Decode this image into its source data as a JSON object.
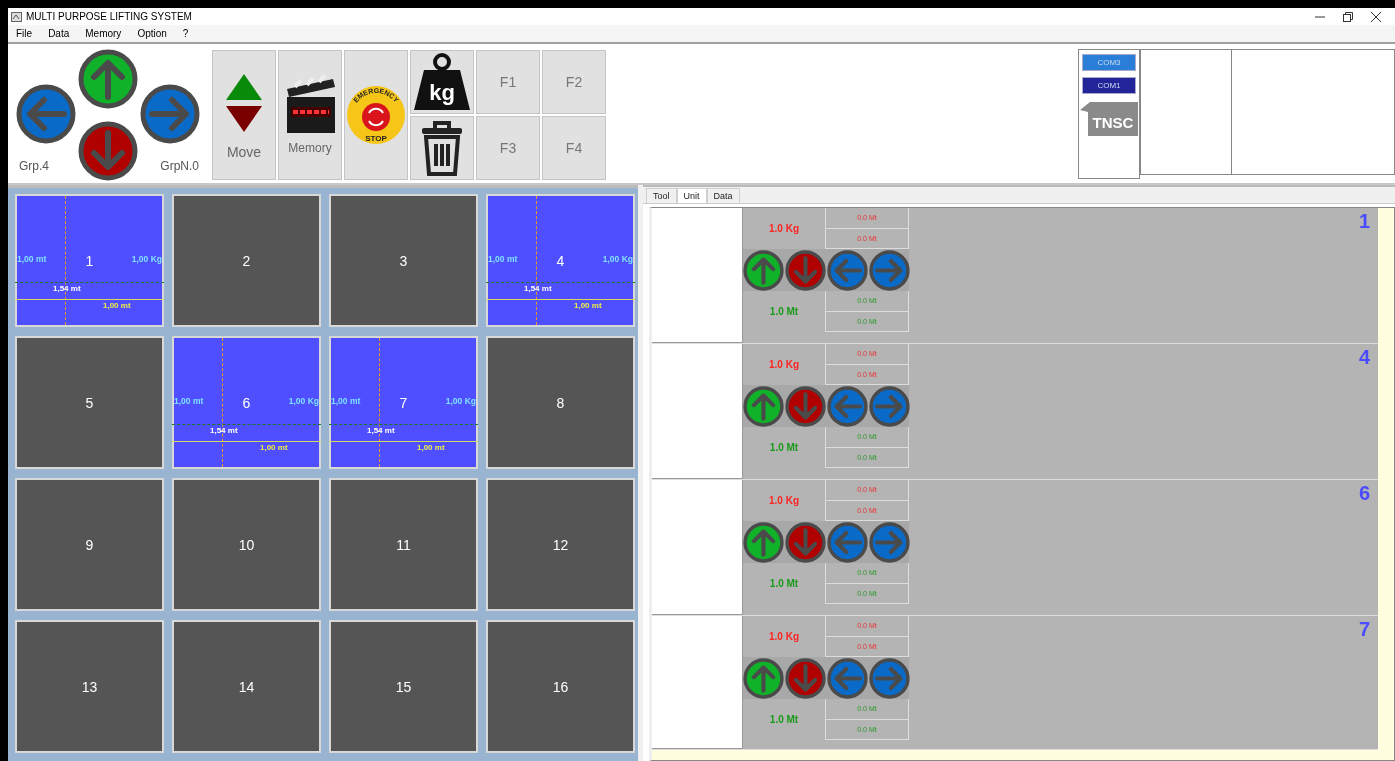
{
  "window": {
    "title": "MULTI PURPOSE LIFTING SYSTEM"
  },
  "menu": [
    "File",
    "Data",
    "Memory",
    "Option",
    "?"
  ],
  "joystick": {
    "group_label": "Grp.4",
    "group_number_label": "GrpN.0"
  },
  "toolbar": {
    "move_label": "Move",
    "memory_label": "Memory",
    "emergency_top": "EMERGENCY",
    "emergency_bottom": "STOP",
    "weight_label": "kg",
    "function_keys": [
      "F1",
      "F2",
      "F3",
      "F4"
    ]
  },
  "ports": [
    {
      "label": "COM3",
      "color": "#2a7ed8"
    },
    {
      "label": "COM1",
      "color": "#23239a"
    }
  ],
  "logo": "TNSC",
  "tiles": [
    {
      "number": "1",
      "selected": true,
      "left": "1,00 mt",
      "right": "1,00 Kg",
      "middle": "1,54 mt",
      "bottom": "1,00 mt"
    },
    {
      "number": "2",
      "selected": false
    },
    {
      "number": "3",
      "selected": false
    },
    {
      "number": "4",
      "selected": true,
      "left": "1,00 mt",
      "right": "1,00 Kg",
      "middle": "1,54 mt",
      "bottom": "1,00 mt"
    },
    {
      "number": "5",
      "selected": false
    },
    {
      "number": "6",
      "selected": true,
      "left": "1,00 mt",
      "right": "1,00 Kg",
      "middle": "1,54 mt",
      "bottom": "1,00 mt"
    },
    {
      "number": "7",
      "selected": true,
      "left": "1,00 mt",
      "right": "1,00 Kg",
      "middle": "1,54 mt",
      "bottom": "1,00 mt"
    },
    {
      "number": "8",
      "selected": false
    },
    {
      "number": "9",
      "selected": false
    },
    {
      "number": "10",
      "selected": false
    },
    {
      "number": "11",
      "selected": false
    },
    {
      "number": "12",
      "selected": false
    },
    {
      "number": "13",
      "selected": false
    },
    {
      "number": "14",
      "selected": false
    },
    {
      "number": "15",
      "selected": false
    },
    {
      "number": "16",
      "selected": false
    }
  ],
  "tabs": [
    {
      "label": "Tool",
      "selected": false
    },
    {
      "label": "Unit",
      "selected": true
    },
    {
      "label": "Data",
      "selected": false
    }
  ],
  "units": [
    {
      "number": "1",
      "weight": "1.0 Kg",
      "weight_readings": [
        "0.0 Mt",
        "0.0 Mt"
      ],
      "height": "1.0 Mt",
      "height_readings": [
        "0.0 Mt",
        "0.0 Mt"
      ]
    },
    {
      "number": "4",
      "weight": "1.0 Kg",
      "weight_readings": [
        "0.0 Mt",
        "0.0 Mt"
      ],
      "height": "1.0 Mt",
      "height_readings": [
        "0.0 Mt",
        "0.0 Mt"
      ]
    },
    {
      "number": "6",
      "weight": "1.0 Kg",
      "weight_readings": [
        "0.0 Mt",
        "0.0 Mt"
      ],
      "height": "1.0 Mt",
      "height_readings": [
        "0.0 Mt",
        "0.0 Mt"
      ]
    },
    {
      "number": "7",
      "weight": "1.0 Kg",
      "weight_readings": [
        "0.0 Mt",
        "0.0 Mt"
      ],
      "height": "1.0 Mt",
      "height_readings": [
        "0.0 Mt",
        "0.0 Mt"
      ]
    }
  ]
}
